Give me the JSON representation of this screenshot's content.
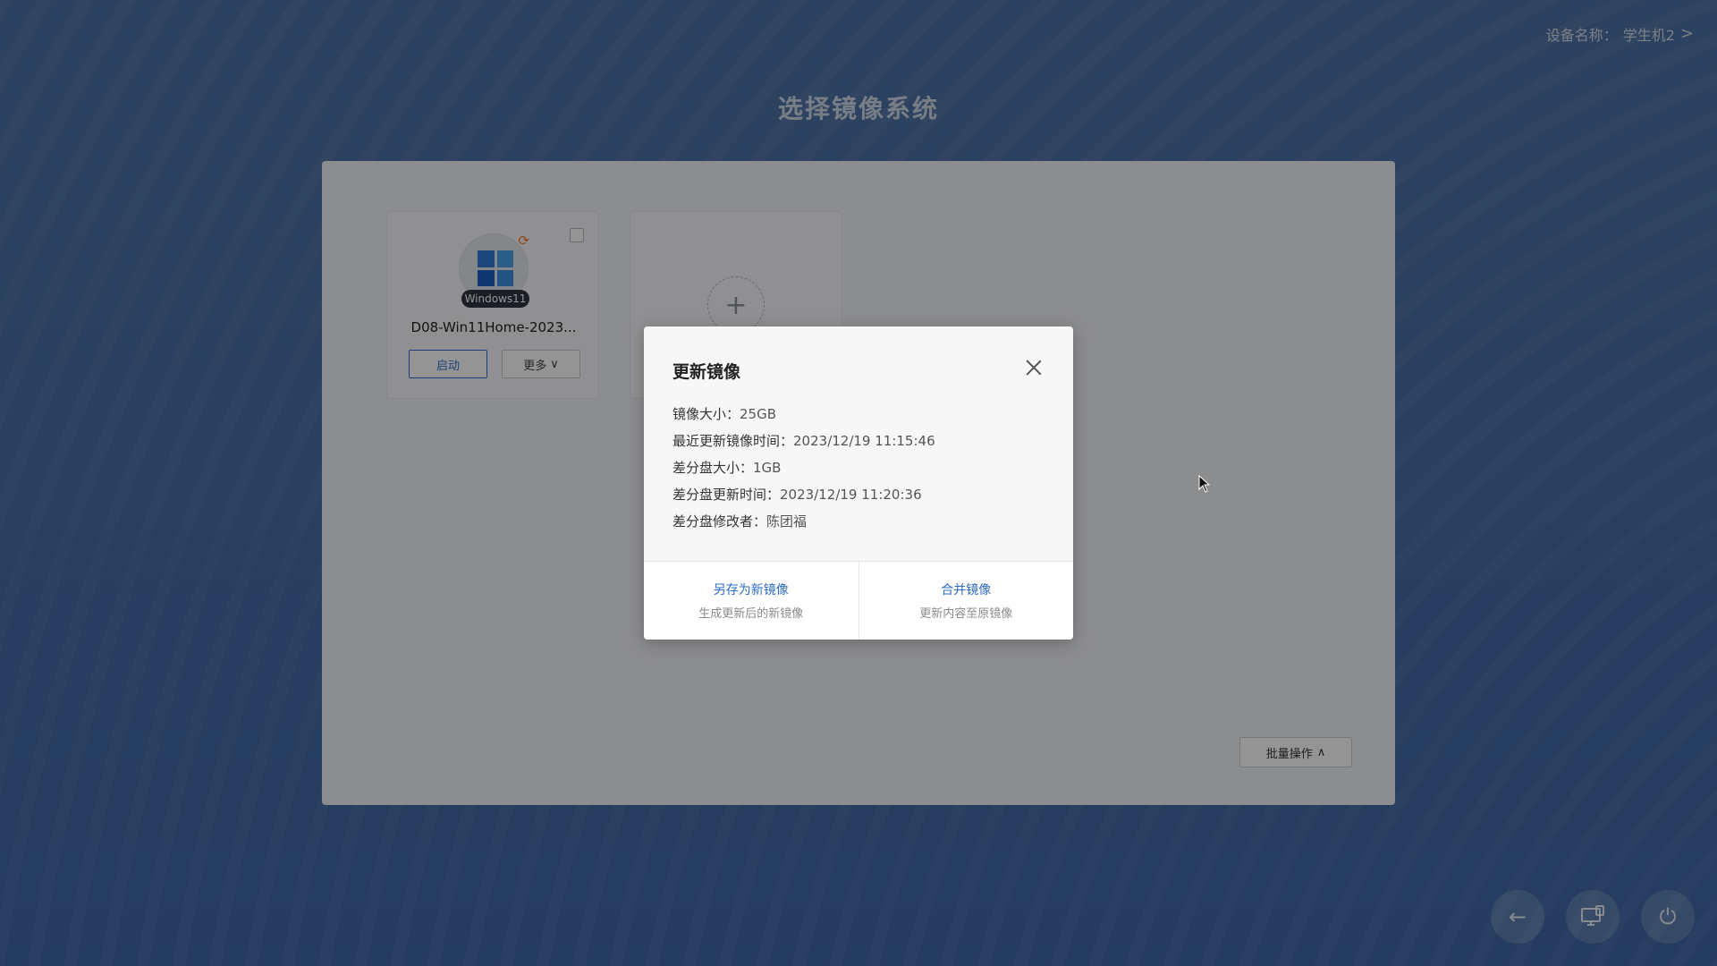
{
  "header": {
    "device_label": "设备名称：",
    "device_value": "学生机2",
    "device_chevron": ">"
  },
  "page_title": "选择镜像系统",
  "images": [
    {
      "os_tag": "Windows11",
      "name": "D08-Win11Home-2023...",
      "start_label": "启动",
      "more_label": "更多",
      "more_chevron": "∨"
    }
  ],
  "add_card": {
    "plus": "+"
  },
  "batch": {
    "label": "批量操作",
    "chevron": "∧"
  },
  "dialog": {
    "title": "更新镜像",
    "info": [
      {
        "label": "镜像大小：",
        "value": "25GB"
      },
      {
        "label": "最近更新镜像时间：",
        "value": "2023/12/19 11:15:46"
      },
      {
        "label": "差分盘大小：",
        "value": "1GB"
      },
      {
        "label": "差分盘更新时间：",
        "value": "2023/12/19 11:20:36"
      },
      {
        "label": "差分盘修改者：",
        "value": "陈团福"
      }
    ],
    "actions": [
      {
        "primary": "另存为新镜像",
        "secondary": "生成更新后的新镜像"
      },
      {
        "primary": "合并镜像",
        "secondary": "更新内容至原镜像"
      }
    ]
  },
  "dock": {
    "back_icon": "←",
    "power_icon": "⏻"
  },
  "colors": {
    "accent": "#2d6cc7",
    "badge": "#ee7a2c",
    "background": "#4a6fa6"
  }
}
